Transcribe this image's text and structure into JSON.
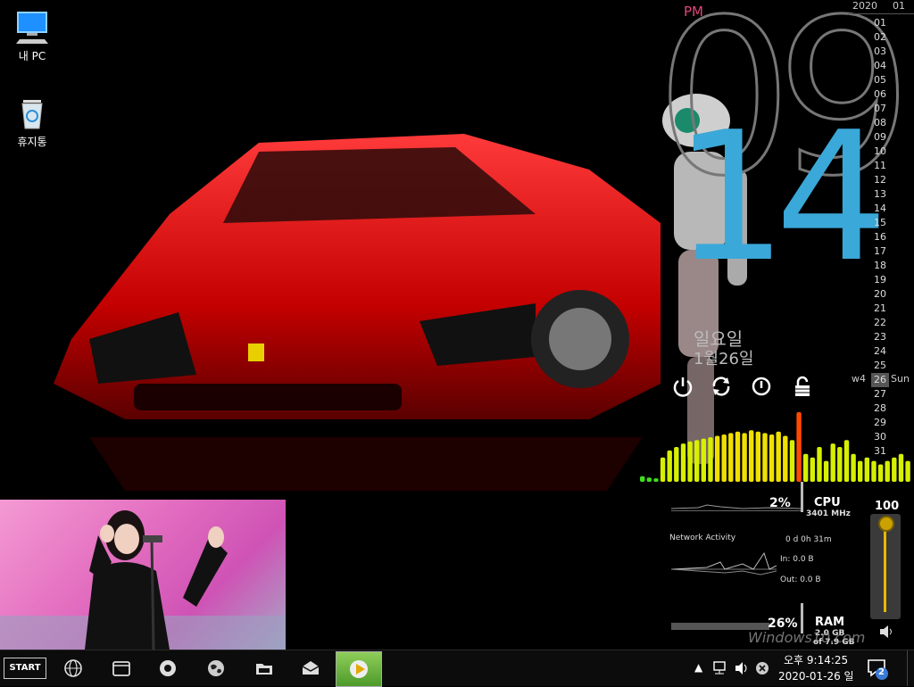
{
  "desktop": {
    "icons": [
      {
        "label": "내 PC",
        "icon": "computer-icon"
      },
      {
        "label": "휴지통",
        "icon": "recycle-bin-icon"
      }
    ]
  },
  "clock_widget": {
    "ampm": "PM",
    "hour": "09",
    "minute": "14",
    "day_name": "일요일",
    "date_label": "1월26일",
    "controls": [
      "power-icon",
      "restart-icon",
      "standby-icon",
      "lock-icon"
    ]
  },
  "calendar": {
    "year": "2020",
    "month": "01",
    "days": [
      "01",
      "02",
      "03",
      "04",
      "05",
      "06",
      "07",
      "08",
      "09",
      "10",
      "11",
      "12",
      "13",
      "14",
      "15",
      "16",
      "17",
      "18",
      "19",
      "20",
      "21",
      "22",
      "23",
      "24",
      "25",
      "26",
      "27",
      "28",
      "29",
      "30",
      "31"
    ],
    "today": "26",
    "week": "w4",
    "weekday": "Sun"
  },
  "visualizer": {
    "levels": [
      0.08,
      0.06,
      0.05,
      0.35,
      0.45,
      0.5,
      0.55,
      0.58,
      0.6,
      0.62,
      0.64,
      0.66,
      0.68,
      0.7,
      0.72,
      0.7,
      0.74,
      0.72,
      0.7,
      0.68,
      0.72,
      0.66,
      0.6,
      1.0,
      0.4,
      0.35,
      0.5,
      0.3,
      0.55,
      0.5,
      0.6,
      0.4,
      0.3,
      0.35,
      0.3,
      0.25,
      0.3,
      0.35,
      0.4,
      0.3
    ],
    "peak_color": "#ff4a00",
    "low_color": "#3ee01e",
    "mid_color": "#d6f000"
  },
  "system": {
    "cpu_percent": "2%",
    "cpu_label": "CPU",
    "cpu_freq": "3401 MHz",
    "network_label": "Network Activity",
    "uptime": "0 d 0h 31m",
    "net_in": "In: 0.0 B",
    "net_out": "Out: 0.0 B",
    "ram_percent": "26%",
    "ram_label": "RAM",
    "ram_used": "2.0 GB",
    "ram_total": "of 7.9 GB"
  },
  "volume": {
    "level": "100",
    "fraction": 1.0
  },
  "watermark": "Windows10.com",
  "taskbar": {
    "start_label": "START",
    "apps": [
      "globe-icon",
      "window-icon",
      "chrome-icon",
      "world-icon",
      "folder-icon",
      "mail-icon",
      "media-player-icon"
    ],
    "tray_time": "오후 9:14:25",
    "tray_date": "2020-01-26 일",
    "notification_count": "2"
  }
}
